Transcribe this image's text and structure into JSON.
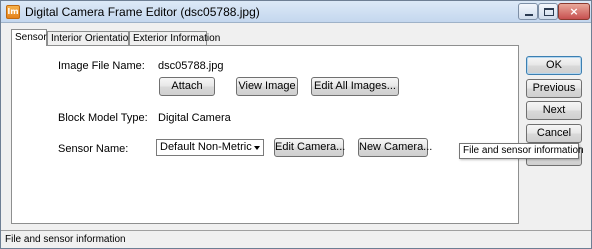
{
  "window": {
    "title": "Digital Camera Frame Editor (dsc05788.jpg)",
    "app_icon_text": "lm",
    "close_glyph": "×"
  },
  "tabs": [
    {
      "label": "Sensor"
    },
    {
      "label": "Interior Orientation"
    },
    {
      "label": "Exterior Information"
    }
  ],
  "sensor_tab": {
    "image_file_label": "Image File Name:",
    "image_file_value": "dsc05788.jpg",
    "attach_button": "Attach",
    "view_image_button": "View Image",
    "edit_all_images_button": "Edit All Images...",
    "block_model_label": "Block Model Type:",
    "block_model_value": "Digital Camera",
    "sensor_name_label": "Sensor Name:",
    "sensor_name_value": "Default Non-Metric",
    "edit_camera_button": "Edit Camera...",
    "new_camera_button": "New Camera..."
  },
  "side_buttons": {
    "ok": "OK",
    "previous": "Previous",
    "next": "Next",
    "cancel": "Cancel"
  },
  "tooltip": "File and sensor information",
  "statusbar": {
    "text": "File and sensor information"
  }
}
